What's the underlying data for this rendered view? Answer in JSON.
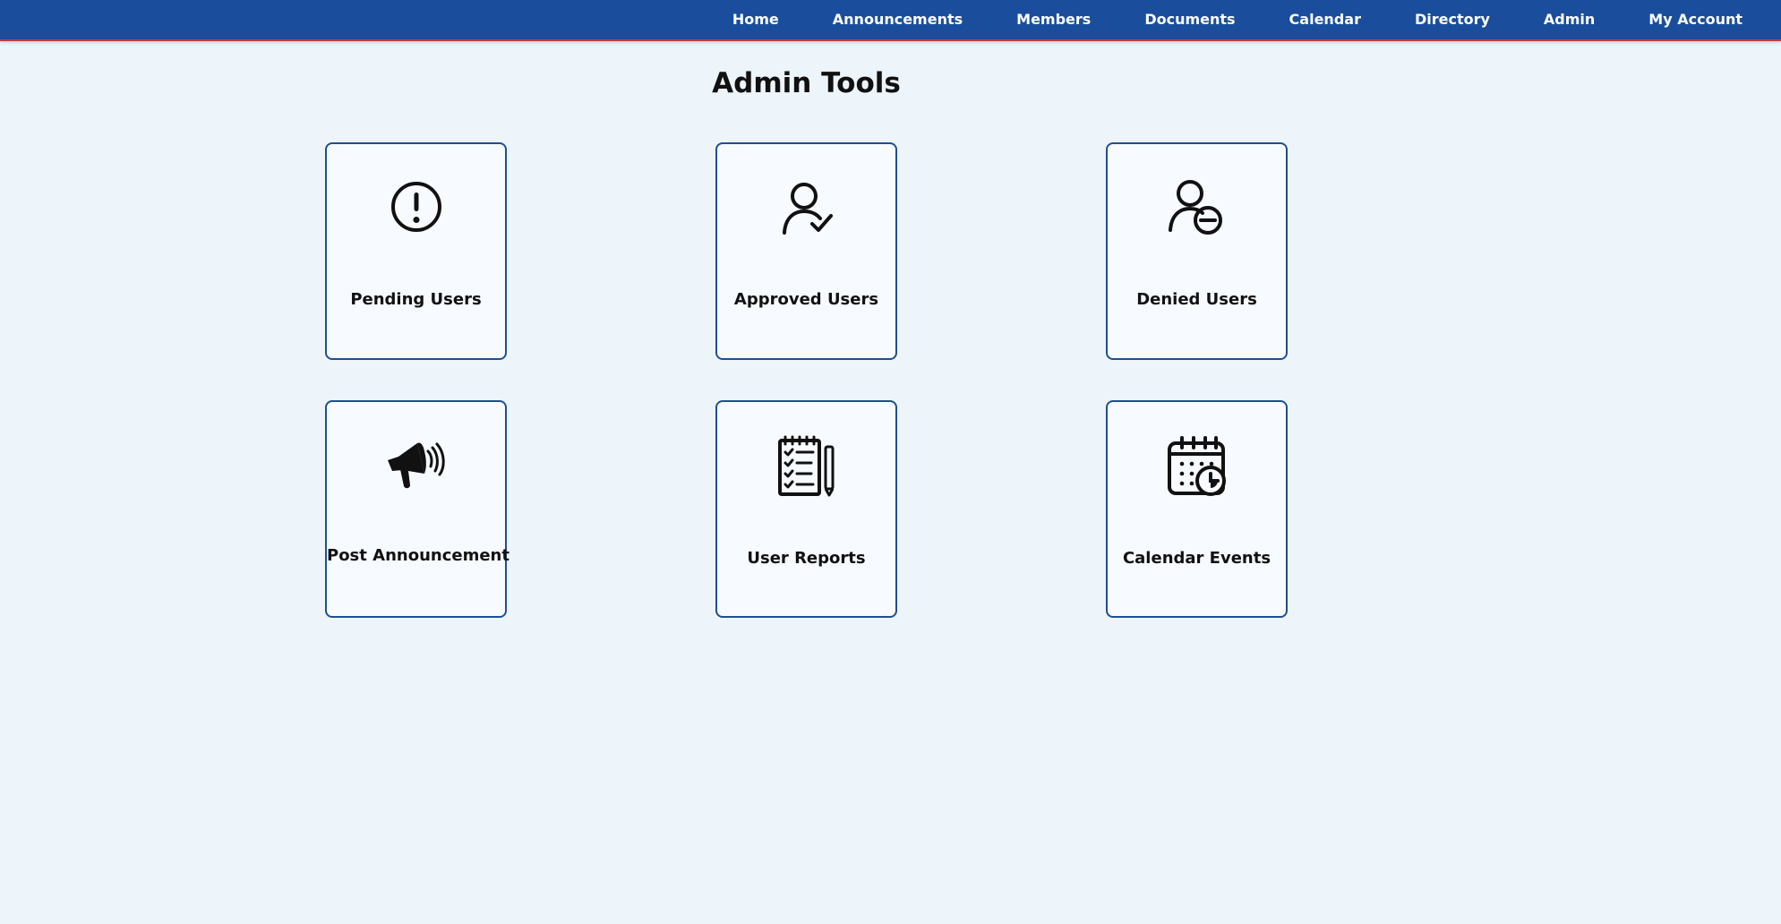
{
  "nav": {
    "items": [
      {
        "label": "Home"
      },
      {
        "label": "Announcements"
      },
      {
        "label": "Members"
      },
      {
        "label": "Documents"
      },
      {
        "label": "Calendar"
      },
      {
        "label": "Directory"
      },
      {
        "label": "Admin"
      },
      {
        "label": "My Account"
      }
    ]
  },
  "page": {
    "title": "Admin Tools"
  },
  "cards": [
    {
      "label": "Pending Users",
      "icon": "exclamation-circle-icon"
    },
    {
      "label": "Approved Users",
      "icon": "user-check-icon"
    },
    {
      "label": "Denied Users",
      "icon": "user-minus-icon"
    },
    {
      "label": "Post Announcement",
      "icon": "megaphone-icon"
    },
    {
      "label": "User Reports",
      "icon": "report-checklist-icon"
    },
    {
      "label": "Calendar Events",
      "icon": "calendar-clock-icon"
    }
  ],
  "colors": {
    "background": "#edf4fa",
    "navbar": "#1a4e9c",
    "navbar_accent": "#c33a3a",
    "card_border": "#1f4f90",
    "card_background": "#f7fbff",
    "text": "#111111"
  }
}
